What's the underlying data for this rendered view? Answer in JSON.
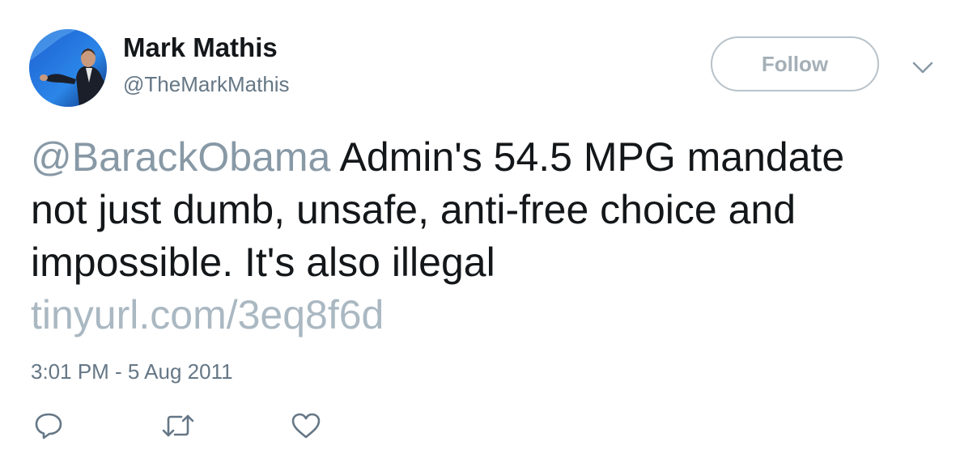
{
  "author": {
    "display_name": "Mark Mathis",
    "handle": "@TheMarkMathis"
  },
  "follow_button": {
    "label": "Follow"
  },
  "tweet": {
    "mention": "@BarackObama",
    "text_line1": " Admin's 54.5 MPG mandate",
    "text_line2": "not just dumb, unsafe, anti-free choice and",
    "text_line3": "impossible. It's also illegal",
    "link": "tinyurl.com/3eq8f6d",
    "timestamp": "3:01 PM - 5 Aug 2011"
  },
  "icons": {
    "reply": "reply-icon",
    "retweet": "retweet-icon",
    "like": "like-icon",
    "menu": "chevron-down-icon"
  },
  "colors": {
    "text": "#14171a",
    "secondary": "#657786",
    "link": "#aab8c2",
    "border": "#b8c2c9"
  }
}
